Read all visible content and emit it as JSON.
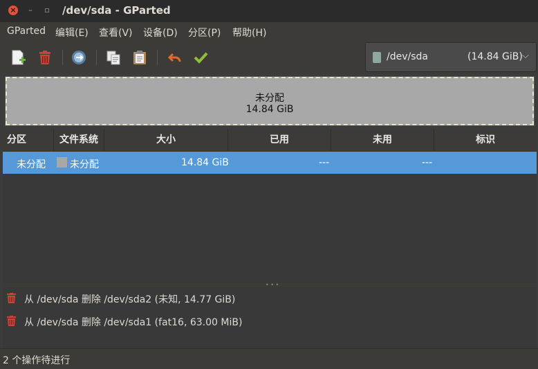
{
  "window": {
    "title": "/dev/sda - GParted",
    "close_glyph": "×",
    "minimize_glyph": "–",
    "maximize_glyph": "▫"
  },
  "menu": [
    "GParted",
    "编辑(E)",
    "查看(V)",
    "设备(D)",
    "分区(P)",
    "帮助(H)"
  ],
  "toolbar": {
    "icons": [
      "new-partition-icon",
      "delete-partition-icon",
      "resize-move-icon",
      "copy-icon",
      "paste-icon",
      "undo-icon",
      "apply-icon"
    ]
  },
  "device": {
    "name": "/dev/sda",
    "size": "(14.84 GiB)",
    "chevron": "⌵"
  },
  "disk_map": {
    "label": "未分配",
    "size": "14.84 GiB"
  },
  "table": {
    "headers": [
      "分区",
      "文件系统",
      "大小",
      "已用",
      "未用",
      "标识"
    ],
    "rows": [
      {
        "partition": "未分配",
        "filesystem": "未分配",
        "size": "14.84 GiB",
        "used": "---",
        "unused": "---",
        "flags": ""
      }
    ]
  },
  "operations": [
    "从 /dev/sda 删除 /dev/sda2 (未知, 14.77 GiB)",
    "从 /dev/sda 删除 /dev/sda1 (fat16, 63.00 MiB)"
  ],
  "status": "2 个操作待进行",
  "colors": {
    "selected_row": "#5599d8",
    "unallocated": "#a8a8a8",
    "close_button": "#e0533b",
    "trash_red": "#c8453a",
    "apply_green": "#8fbf3a",
    "undo_orange": "#e06a2a"
  }
}
